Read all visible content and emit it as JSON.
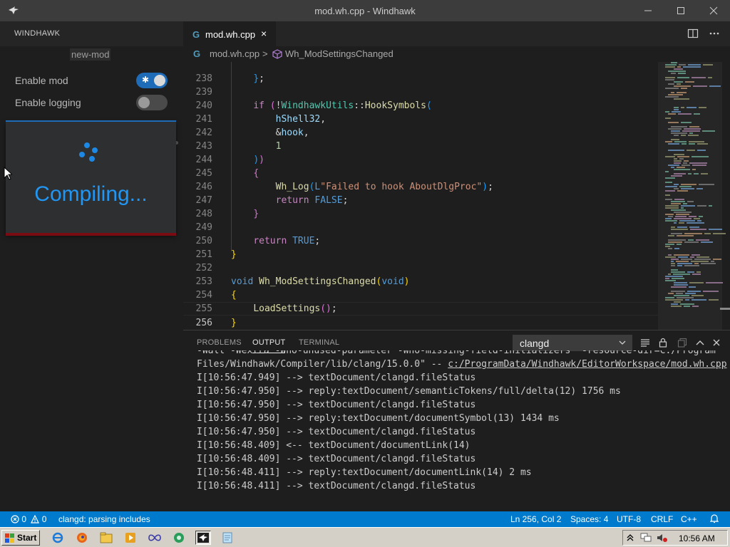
{
  "window": {
    "title": "mod.wh.cpp - Windhawk",
    "app_icon": "windhawk-bird-icon",
    "controls": [
      "minimize-icon",
      "maximize-icon",
      "close-icon"
    ]
  },
  "sidebar": {
    "header": "WINDHAWK",
    "mod_name": "new-mod",
    "enable_mod": {
      "label": "Enable mod",
      "on": true
    },
    "enable_logging": {
      "label": "Enable logging",
      "on": false
    },
    "compile_status": "Compiling..."
  },
  "editor": {
    "tab": {
      "label": "mod.wh.cpp",
      "icon": "cpp-file-icon",
      "close": "×"
    },
    "breadcrumb": {
      "file": "mod.wh.cpp",
      "separator": ">",
      "symbol": "Wh_ModSettingsChanged"
    },
    "line_numbers": [
      "238",
      "239",
      "240",
      "241",
      "242",
      "243",
      "244",
      "245",
      "246",
      "247",
      "248",
      "249",
      "250",
      "251",
      "252",
      "253",
      "254",
      "255",
      "256"
    ],
    "lines": [
      "    };",
      "",
      "    if (!WindhawkUtils::HookSymbols(",
      "        hShell32,",
      "        &hook,",
      "        1",
      "    ))",
      "    {",
      "        Wh_Log(L\"Failed to hook AboutDlgProc\");",
      "        return FALSE;",
      "    }",
      "",
      "    return TRUE;",
      "}",
      "",
      "void Wh_ModSettingsChanged(void)",
      "{",
      "    LoadSettings();",
      "}"
    ]
  },
  "panel": {
    "tabs": [
      "PROBLEMS",
      "OUTPUT",
      "TERMINAL"
    ],
    "active_tab": "OUTPUT",
    "channel": "clangd",
    "output_lines": [
      "-Wall -Wextra -Wno-unused-parameter -Wno-missing-field-initializers  -resource-dir=C:/Program",
      "Files/Windhawk/Compiler/lib/clang/15.0.0\" -- ",
      "I[10:56:47.949] --> textDocument/clangd.fileStatus",
      "I[10:56:47.950] --> reply:textDocument/semanticTokens/full/delta(12) 1756 ms",
      "I[10:56:47.950] --> textDocument/clangd.fileStatus",
      "I[10:56:47.950] --> reply:textDocument/documentSymbol(13) 1434 ms",
      "I[10:56:47.950] --> textDocument/clangd.fileStatus",
      "I[10:56:48.409] <-- textDocument/documentLink(14)",
      "I[10:56:48.409] --> textDocument/clangd.fileStatus",
      "I[10:56:48.411] --> reply:textDocument/documentLink(14) 2 ms",
      "I[10:56:48.411] --> textDocument/clangd.fileStatus"
    ],
    "output_link": "c:/ProgramData/Windhawk/EditorWorkspace/mod.wh.cpp"
  },
  "statusbar": {
    "errors": "0",
    "warnings": "0",
    "message": "clangd: parsing includes",
    "position": "Ln 256, Col 2",
    "spaces": "Spaces: 4",
    "encoding": "UTF-8",
    "eol": "CRLF",
    "language": "C++"
  },
  "taskbar": {
    "start_label": "Start",
    "clock": "10:56 AM"
  },
  "colors": {
    "accent": "#007acc",
    "compile_text": "#2196f3",
    "toggle_on": "#1e6bb8"
  }
}
